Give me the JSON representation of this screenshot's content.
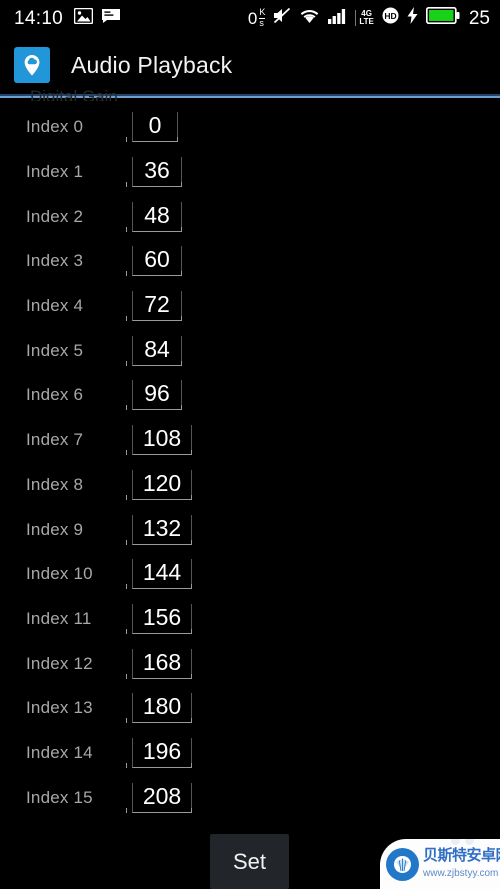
{
  "status_bar": {
    "time": "14:10",
    "left_icons": [
      "image-icon",
      "message-icon"
    ],
    "network_rate": "0",
    "rate_unit_top": "K",
    "rate_unit_bottom": "s",
    "mute_icon": "mute-icon",
    "wifi_icon": "wifi-icon",
    "signal_icon": "signal-bars-icon",
    "network_type": "4G",
    "network_type_sub": "LTE",
    "hd_icon": "hd-icon",
    "charging_icon": "charging-bolt-icon",
    "battery_icon": "battery-icon",
    "battery_percent": "25"
  },
  "action_bar": {
    "app_icon": "cloud-pin-icon",
    "title": "Audio Playback"
  },
  "content": {
    "scrolled_header": "Digital Gain",
    "rows": [
      {
        "label": "Index 0",
        "value": "0"
      },
      {
        "label": "Index 1",
        "value": "36"
      },
      {
        "label": "Index 2",
        "value": "48"
      },
      {
        "label": "Index 3",
        "value": "60"
      },
      {
        "label": "Index 4",
        "value": "72"
      },
      {
        "label": "Index 5",
        "value": "84"
      },
      {
        "label": "Index 6",
        "value": "96"
      },
      {
        "label": "Index 7",
        "value": "108"
      },
      {
        "label": "Index 8",
        "value": "120"
      },
      {
        "label": "Index 9",
        "value": "132"
      },
      {
        "label": "Index 10",
        "value": "144"
      },
      {
        "label": "Index 11",
        "value": "156"
      },
      {
        "label": "Index 12",
        "value": "168"
      },
      {
        "label": "Index 13",
        "value": "180"
      },
      {
        "label": "Index 14",
        "value": "196"
      },
      {
        "label": "Index 15",
        "value": "208"
      }
    ]
  },
  "footer": {
    "set_label": "Set"
  },
  "watermark": {
    "site_name": "贝斯特安卓网",
    "url": "www.zjbstyy.com",
    "logo": "shell-logo-icon"
  },
  "colors": {
    "background": "#000000",
    "accent_blue": "#2196d9",
    "divider": "#6f9fd0",
    "label_text": "#a8a8a8",
    "value_text": "#ffffff",
    "button_bg": "#22262b"
  }
}
